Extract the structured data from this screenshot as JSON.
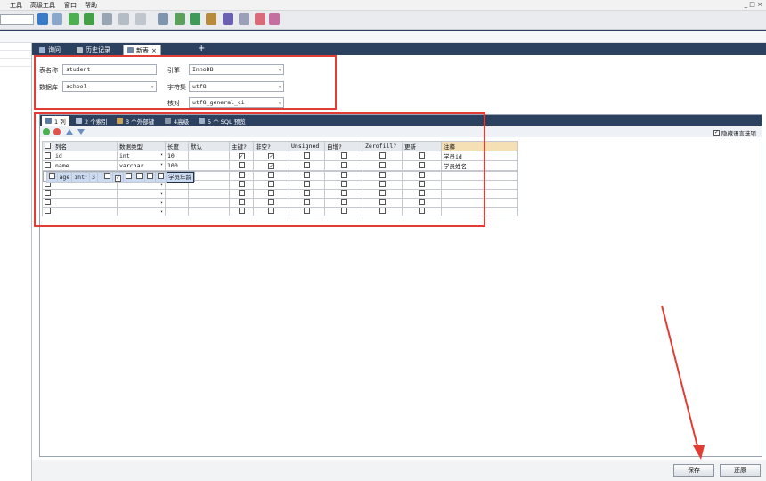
{
  "menu": {
    "items": [
      "工具",
      "高级工具",
      "窗口",
      "帮助"
    ]
  },
  "window": {
    "controls": "_ □ ×"
  },
  "tabs": {
    "items": [
      {
        "label": "询问",
        "icon": "query-icon"
      },
      {
        "label": "历史记录",
        "icon": "history-icon"
      },
      {
        "label": "新表",
        "icon": "new-table-icon",
        "close": "×"
      }
    ],
    "add": "+"
  },
  "form": {
    "table_name_label": "表名称",
    "table_name_value": "student",
    "database_label": "数据库",
    "database_value": "school",
    "engine_label": "引擎",
    "engine_value": "InnoDB",
    "charset_label": "字符集",
    "charset_value": "utf8",
    "collation_label": "核对",
    "collation_value": "utf8_general_ci"
  },
  "subtabs": [
    {
      "label": "1 列"
    },
    {
      "label": "2 个索引"
    },
    {
      "label": "3 个外部键"
    },
    {
      "label": "4高级"
    },
    {
      "label": "5 个 SQL 预览"
    }
  ],
  "grid_toolbar": {
    "hide_comment_label": "隐藏语言选项"
  },
  "columns_table": {
    "headers": [
      "列名",
      "数据类型",
      "长度",
      "默认",
      "主键?",
      "非空?",
      "Unsigned",
      "自增?",
      "Zerofill?",
      "更新",
      "注释"
    ],
    "rows": [
      {
        "name": "id",
        "type": "int",
        "length": "10",
        "default": "",
        "pk": true,
        "notnull": true,
        "unsigned": false,
        "autoinc": false,
        "zerofill": false,
        "update": false,
        "comment": "学员id"
      },
      {
        "name": "name",
        "type": "varchar",
        "length": "100",
        "default": "",
        "pk": false,
        "notnull": true,
        "unsigned": false,
        "autoinc": false,
        "zerofill": false,
        "update": false,
        "comment": "学员姓名"
      },
      {
        "name": "age",
        "type": "int",
        "length": "3",
        "default": "",
        "pk": false,
        "notnull": true,
        "unsigned": false,
        "autoinc": false,
        "zerofill": false,
        "update": false,
        "comment": "学员年龄"
      },
      {
        "name": "",
        "type": "",
        "length": "",
        "default": "",
        "pk": false,
        "notnull": false,
        "unsigned": false,
        "autoinc": false,
        "zerofill": false,
        "update": false,
        "comment": ""
      },
      {
        "name": "",
        "type": "",
        "length": "",
        "default": "",
        "pk": false,
        "notnull": false,
        "unsigned": false,
        "autoinc": false,
        "zerofill": false,
        "update": false,
        "comment": ""
      },
      {
        "name": "",
        "type": "",
        "length": "",
        "default": "",
        "pk": false,
        "notnull": false,
        "unsigned": false,
        "autoinc": false,
        "zerofill": false,
        "update": false,
        "comment": ""
      },
      {
        "name": "",
        "type": "",
        "length": "",
        "default": "",
        "pk": false,
        "notnull": false,
        "unsigned": false,
        "autoinc": false,
        "zerofill": false,
        "update": false,
        "comment": ""
      },
      {
        "name": "",
        "type": "",
        "length": "",
        "default": "",
        "pk": false,
        "notnull": false,
        "unsigned": false,
        "autoinc": false,
        "zerofill": false,
        "update": false,
        "comment": ""
      }
    ]
  },
  "buttons": {
    "save": "保存",
    "revert": "还原"
  },
  "colors": {
    "frame": "#2c4160",
    "highlight": "#e23c35",
    "selected_row": "#c9daf2"
  }
}
